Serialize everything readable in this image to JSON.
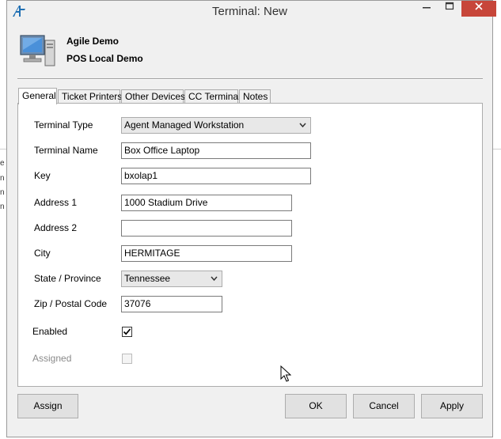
{
  "window": {
    "title": "Terminal: New"
  },
  "header": {
    "organization": "Agile Demo",
    "location": "POS Local Demo"
  },
  "tabs": [
    {
      "label": "General",
      "active": true
    },
    {
      "label": "Ticket Printers",
      "active": false
    },
    {
      "label": "Other Devices",
      "active": false
    },
    {
      "label": "CC Terminal",
      "active": false
    },
    {
      "label": "Notes",
      "active": false
    }
  ],
  "form": {
    "terminal_type": {
      "label": "Terminal Type",
      "value": "Agent Managed Workstation"
    },
    "terminal_name": {
      "label": "Terminal Name",
      "value": "Box Office Laptop"
    },
    "key": {
      "label": "Key",
      "value": "bxolap1"
    },
    "address1": {
      "label": "Address 1",
      "value": "1000 Stadium Drive"
    },
    "address2": {
      "label": "Address 2",
      "value": ""
    },
    "city": {
      "label": "City",
      "value": "HERMITAGE"
    },
    "state": {
      "label": "State / Province",
      "value": "Tennessee"
    },
    "zip": {
      "label": "Zip / Postal Code",
      "value": "37076"
    },
    "enabled": {
      "label": "Enabled",
      "checked": true
    },
    "assigned": {
      "label": "Assigned",
      "checked": false,
      "disabled": true
    }
  },
  "buttons": {
    "assign": "Assign",
    "ok": "OK",
    "cancel": "Cancel",
    "apply": "Apply"
  },
  "background": {
    "chars": [
      "e",
      "n",
      "n",
      "n"
    ]
  },
  "icons": {
    "app": "app-logo-icon",
    "header": "computer-terminal-icon",
    "minimize": "minimize-icon",
    "maximize": "maximize-icon",
    "close": "close-icon",
    "dropdown": "chevron-down-icon",
    "check": "checkmark-icon",
    "cursor": "mouse-pointer-icon"
  },
  "colors": {
    "close_button": "#c7463a",
    "window_bg": "#f0f0f0",
    "app_icon": "#1f6fb3"
  }
}
